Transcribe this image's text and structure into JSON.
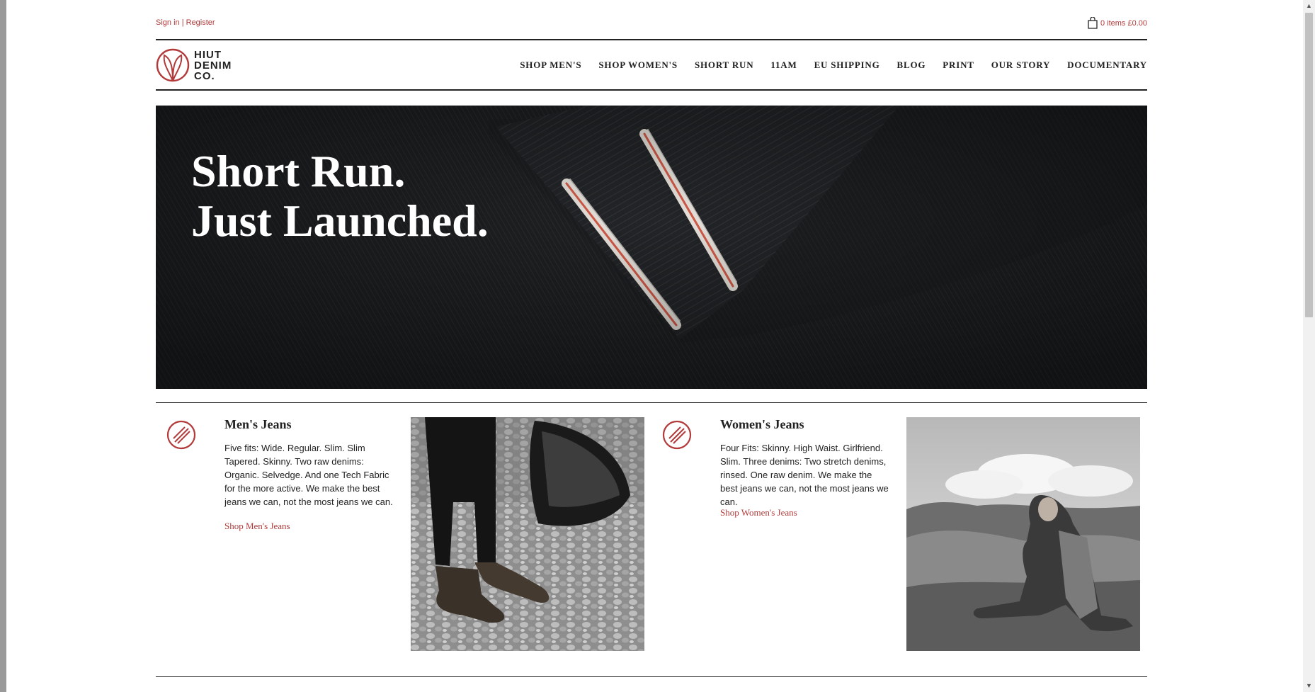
{
  "header": {
    "sign_in": "Sign in",
    "separator": "|",
    "register": "Register",
    "cart_text": "0 items £0.00",
    "logo_lines": [
      "HIUT",
      "DENIM",
      "CO."
    ]
  },
  "nav": {
    "items": [
      "SHOP MEN'S",
      "SHOP WOMEN'S",
      "SHORT RUN",
      "11AM",
      "EU SHIPPING",
      "BLOG",
      "PRINT",
      "OUR STORY",
      "DOCUMENTARY"
    ]
  },
  "hero": {
    "line1": "Short Run.",
    "line2": "Just Launched."
  },
  "mens": {
    "title": "Men's Jeans",
    "body": "Five fits: Wide. Regular. Slim. Slim Tapered. Skinny. Two raw denims: Organic. Selvedge. And one Tech Fabric for the more active. We make the best jeans we can, not the most jeans we can.",
    "link": "Shop Men's Jeans"
  },
  "womens": {
    "title": "Women's Jeans",
    "body": "Four Fits: Skinny. High Waist. Girlfriend. Slim. Three denims: Two stretch denims, rinsed. One raw denim. We make the best jeans we can, not the most jeans we can.",
    "link": "Shop Women's Jeans"
  },
  "colors": {
    "accent": "#b23a3a",
    "text": "#222222",
    "hero_bg": "#1c1e20"
  },
  "icons": {
    "cart": "shopping-bag-icon",
    "logo": "hiut-leaf-logo",
    "card": "striped-circle-icon"
  }
}
